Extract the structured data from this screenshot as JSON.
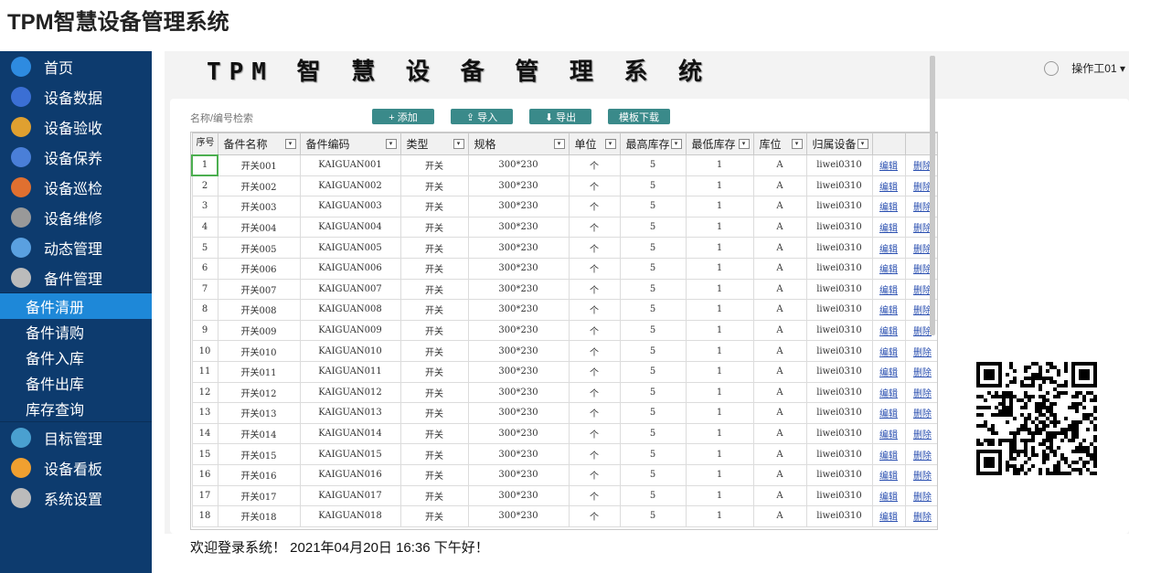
{
  "page_title": "TPM智慧设备管理系统",
  "banner_title": "TPM 智 慧 设 备 管 理 系 统",
  "user": {
    "name": "操作工01 ▾"
  },
  "sidebar": {
    "items": [
      {
        "label": "首页",
        "icon": "home-icon",
        "color": "#2e8be0"
      },
      {
        "label": "设备数据",
        "icon": "data-icon",
        "color": "#3b6fd4"
      },
      {
        "label": "设备验收",
        "icon": "checklist-icon",
        "color": "#e0a030"
      },
      {
        "label": "设备保养",
        "icon": "maintenance-icon",
        "color": "#4a7fd8"
      },
      {
        "label": "设备巡检",
        "icon": "inspection-icon",
        "color": "#e07030"
      },
      {
        "label": "设备维修",
        "icon": "tools-icon",
        "color": "#999999"
      },
      {
        "label": "动态管理",
        "icon": "share-icon",
        "color": "#5aa0e0"
      },
      {
        "label": "备件管理",
        "icon": "parts-icon",
        "color": "#bbbbbb"
      }
    ],
    "sub_items": [
      "备件清册",
      "备件请购",
      "备件入库",
      "备件出库",
      "库存查询"
    ],
    "items_after": [
      {
        "label": "目标管理",
        "icon": "target-icon",
        "color": "#4aa0d0"
      },
      {
        "label": "设备看板",
        "icon": "board-icon",
        "color": "#f0a030"
      },
      {
        "label": "系统设置",
        "icon": "gear-icon",
        "color": "#bbbbbb"
      }
    ]
  },
  "search": {
    "placeholder": "名称/编号检索"
  },
  "toolbar": {
    "add": "+ 添加",
    "import": "⇪ 导入",
    "export": "⬇ 导出",
    "template": "模板下载"
  },
  "table": {
    "headers": [
      "序号",
      "备件名称",
      "备件编码",
      "类型",
      "规格",
      "单位",
      "最高库存",
      "最低库存",
      "库位",
      "归属设备",
      "",
      ""
    ],
    "rows": [
      [
        "1",
        "开关001",
        "KAIGUAN001",
        "开关",
        "300*230",
        "个",
        "5",
        "1",
        "A",
        "liwei0310",
        "编辑",
        "删除"
      ],
      [
        "2",
        "开关002",
        "KAIGUAN002",
        "开关",
        "300*230",
        "个",
        "5",
        "1",
        "A",
        "liwei0310",
        "编辑",
        "删除"
      ],
      [
        "3",
        "开关003",
        "KAIGUAN003",
        "开关",
        "300*230",
        "个",
        "5",
        "1",
        "A",
        "liwei0310",
        "编辑",
        "删除"
      ],
      [
        "4",
        "开关004",
        "KAIGUAN004",
        "开关",
        "300*230",
        "个",
        "5",
        "1",
        "A",
        "liwei0310",
        "编辑",
        "删除"
      ],
      [
        "5",
        "开关005",
        "KAIGUAN005",
        "开关",
        "300*230",
        "个",
        "5",
        "1",
        "A",
        "liwei0310",
        "编辑",
        "删除"
      ],
      [
        "6",
        "开关006",
        "KAIGUAN006",
        "开关",
        "300*230",
        "个",
        "5",
        "1",
        "A",
        "liwei0310",
        "编辑",
        "删除"
      ],
      [
        "7",
        "开关007",
        "KAIGUAN007",
        "开关",
        "300*230",
        "个",
        "5",
        "1",
        "A",
        "liwei0310",
        "编辑",
        "删除"
      ],
      [
        "8",
        "开关008",
        "KAIGUAN008",
        "开关",
        "300*230",
        "个",
        "5",
        "1",
        "A",
        "liwei0310",
        "编辑",
        "删除"
      ],
      [
        "9",
        "开关009",
        "KAIGUAN009",
        "开关",
        "300*230",
        "个",
        "5",
        "1",
        "A",
        "liwei0310",
        "编辑",
        "删除"
      ],
      [
        "10",
        "开关010",
        "KAIGUAN010",
        "开关",
        "300*230",
        "个",
        "5",
        "1",
        "A",
        "liwei0310",
        "编辑",
        "删除"
      ],
      [
        "11",
        "开关011",
        "KAIGUAN011",
        "开关",
        "300*230",
        "个",
        "5",
        "1",
        "A",
        "liwei0310",
        "编辑",
        "删除"
      ],
      [
        "12",
        "开关012",
        "KAIGUAN012",
        "开关",
        "300*230",
        "个",
        "5",
        "1",
        "A",
        "liwei0310",
        "编辑",
        "删除"
      ],
      [
        "13",
        "开关013",
        "KAIGUAN013",
        "开关",
        "300*230",
        "个",
        "5",
        "1",
        "A",
        "liwei0310",
        "编辑",
        "删除"
      ],
      [
        "14",
        "开关014",
        "KAIGUAN014",
        "开关",
        "300*230",
        "个",
        "5",
        "1",
        "A",
        "liwei0310",
        "编辑",
        "删除"
      ],
      [
        "15",
        "开关015",
        "KAIGUAN015",
        "开关",
        "300*230",
        "个",
        "5",
        "1",
        "A",
        "liwei0310",
        "编辑",
        "删除"
      ],
      [
        "16",
        "开关016",
        "KAIGUAN016",
        "开关",
        "300*230",
        "个",
        "5",
        "1",
        "A",
        "liwei0310",
        "编辑",
        "删除"
      ],
      [
        "17",
        "开关017",
        "KAIGUAN017",
        "开关",
        "300*230",
        "个",
        "5",
        "1",
        "A",
        "liwei0310",
        "编辑",
        "删除"
      ],
      [
        "18",
        "开关018",
        "KAIGUAN018",
        "开关",
        "300*230",
        "个",
        "5",
        "1",
        "A",
        "liwei0310",
        "编辑",
        "删除"
      ]
    ]
  },
  "footer": {
    "text": "欢迎登录系统！  2021年04月20日 16:36 下午好！"
  },
  "colors": {
    "sidebar_bg": "#0d3b6e",
    "active_bg": "#1e88d8",
    "button_bg": "#3a8a8a",
    "link": "#2a4fb0"
  }
}
